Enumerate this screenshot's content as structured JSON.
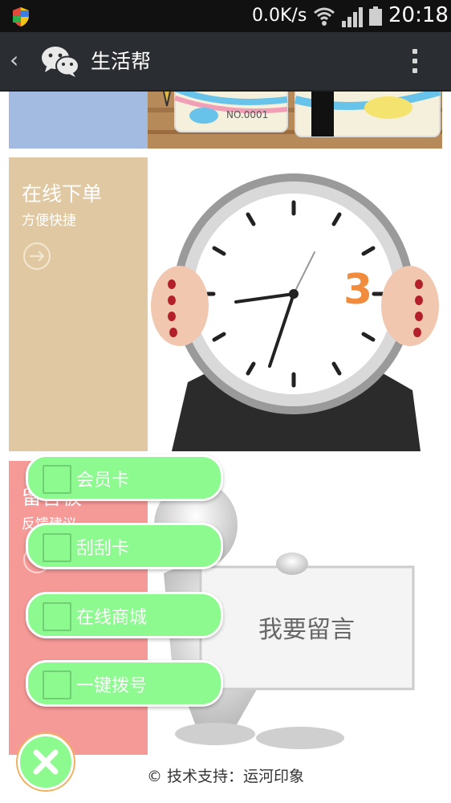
{
  "status_bar": {
    "speed": "0.0K/s",
    "time": "20:18",
    "icons": [
      "shield-icon",
      "wifi-icon",
      "signal-icon",
      "battery-icon"
    ]
  },
  "title_bar": {
    "back_icon": "‹",
    "title": "生活帮",
    "icons": [
      "back-icon",
      "wechat-icon",
      "overflow-menu-icon"
    ]
  },
  "tiles": [
    {
      "title": "在线下单",
      "subtitle": "方便快捷",
      "color": "#e0c9a2",
      "image_text": "3"
    },
    {
      "title": "留言板",
      "subtitle": "反馈建议",
      "color": "#f69a98",
      "image_text": "我要留言"
    }
  ],
  "top_tile": {
    "color": "#a3bbe1",
    "card_text": "NO.0001"
  },
  "floating_menu": {
    "items": [
      {
        "label": "会员卡"
      },
      {
        "label": "刮刮卡"
      },
      {
        "label": "在线商城"
      },
      {
        "label": "一键拨号"
      }
    ],
    "accent": "#8cfa8f"
  },
  "footer": {
    "text": "© 技术支持：运河印象"
  }
}
